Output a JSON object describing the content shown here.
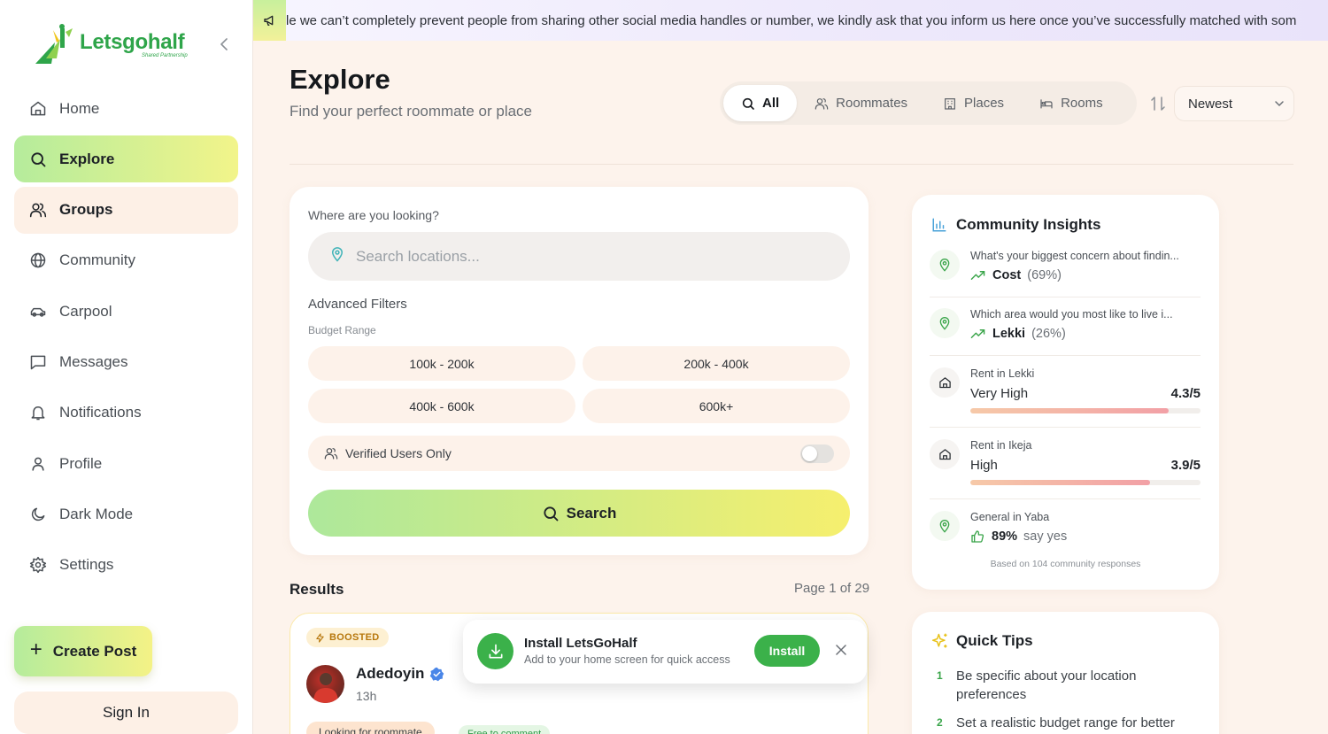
{
  "brand": {
    "name": "Letsgohalf",
    "tagline": "Shared Partnership",
    "accent": "#2fa54a"
  },
  "banner": {
    "text": "le we can’t completely prevent people from sharing other social media handles or number, we kindly ask that you inform us here once you’ve successfully matched with som"
  },
  "nav": {
    "items": [
      {
        "label": "Home",
        "icon": "home-icon"
      },
      {
        "label": "Explore",
        "icon": "search-icon"
      },
      {
        "label": "Groups",
        "icon": "users-icon"
      },
      {
        "label": "Community",
        "icon": "globe-icon"
      },
      {
        "label": "Carpool",
        "icon": "car-icon"
      },
      {
        "label": "Messages",
        "icon": "message-icon"
      },
      {
        "label": "Notifications",
        "icon": "bell-icon"
      },
      {
        "label": "Profile",
        "icon": "user-icon"
      },
      {
        "label": "Dark Mode",
        "icon": "moon-icon"
      },
      {
        "label": "Settings",
        "icon": "gear-icon"
      }
    ],
    "create_post": "Create Post",
    "sign_in": "Sign In"
  },
  "header": {
    "title": "Explore",
    "subtitle": "Find your perfect roommate or place",
    "tabs": [
      {
        "label": "All",
        "icon": "search-icon"
      },
      {
        "label": "Roommates",
        "icon": "users-icon"
      },
      {
        "label": "Places",
        "icon": "building-icon"
      },
      {
        "label": "Rooms",
        "icon": "bed-icon"
      }
    ],
    "sort": "Newest"
  },
  "search": {
    "label": "Where are you looking?",
    "placeholder": "Search locations...",
    "advanced": "Advanced Filters",
    "budget_label": "Budget Range",
    "budgets": [
      "100k - 200k",
      "200k - 400k",
      "400k - 600k",
      "600k+"
    ],
    "verified": "Verified Users Only",
    "button": "Search"
  },
  "results": {
    "title": "Results",
    "page": "Page 1 of 29",
    "post": {
      "badge": "BOOSTED",
      "name": "Adedoyin",
      "time": "13h",
      "tag1": "Looking for roommate",
      "tag2": "Free to comment"
    }
  },
  "install": {
    "title": "Install LetsGoHalf",
    "subtitle": "Add to your home screen for quick access",
    "button": "Install"
  },
  "insights": {
    "title": "Community Insights",
    "polls": [
      {
        "question": "What's your biggest concern about findin...",
        "answer": "Cost",
        "percent": "(69%)"
      },
      {
        "question": "Which area would you most like to live i...",
        "answer": "Lekki",
        "percent": "(26%)"
      }
    ],
    "ratings": [
      {
        "label": "Rent in Lekki",
        "level": "Very High",
        "score": "4.3/5",
        "value": 4.3
      },
      {
        "label": "Rent in Ikeja",
        "level": "High",
        "score": "3.9/5",
        "value": 3.9
      }
    ],
    "general": {
      "label": "General in Yaba",
      "percent": "89%",
      "text": "say yes"
    },
    "footer": "Based on 104 community responses"
  },
  "tips": {
    "title": "Quick Tips",
    "items": [
      {
        "num": "1",
        "text": "Be specific about your location preferences"
      },
      {
        "num": "2",
        "text": "Set a realistic budget range for better"
      }
    ]
  }
}
